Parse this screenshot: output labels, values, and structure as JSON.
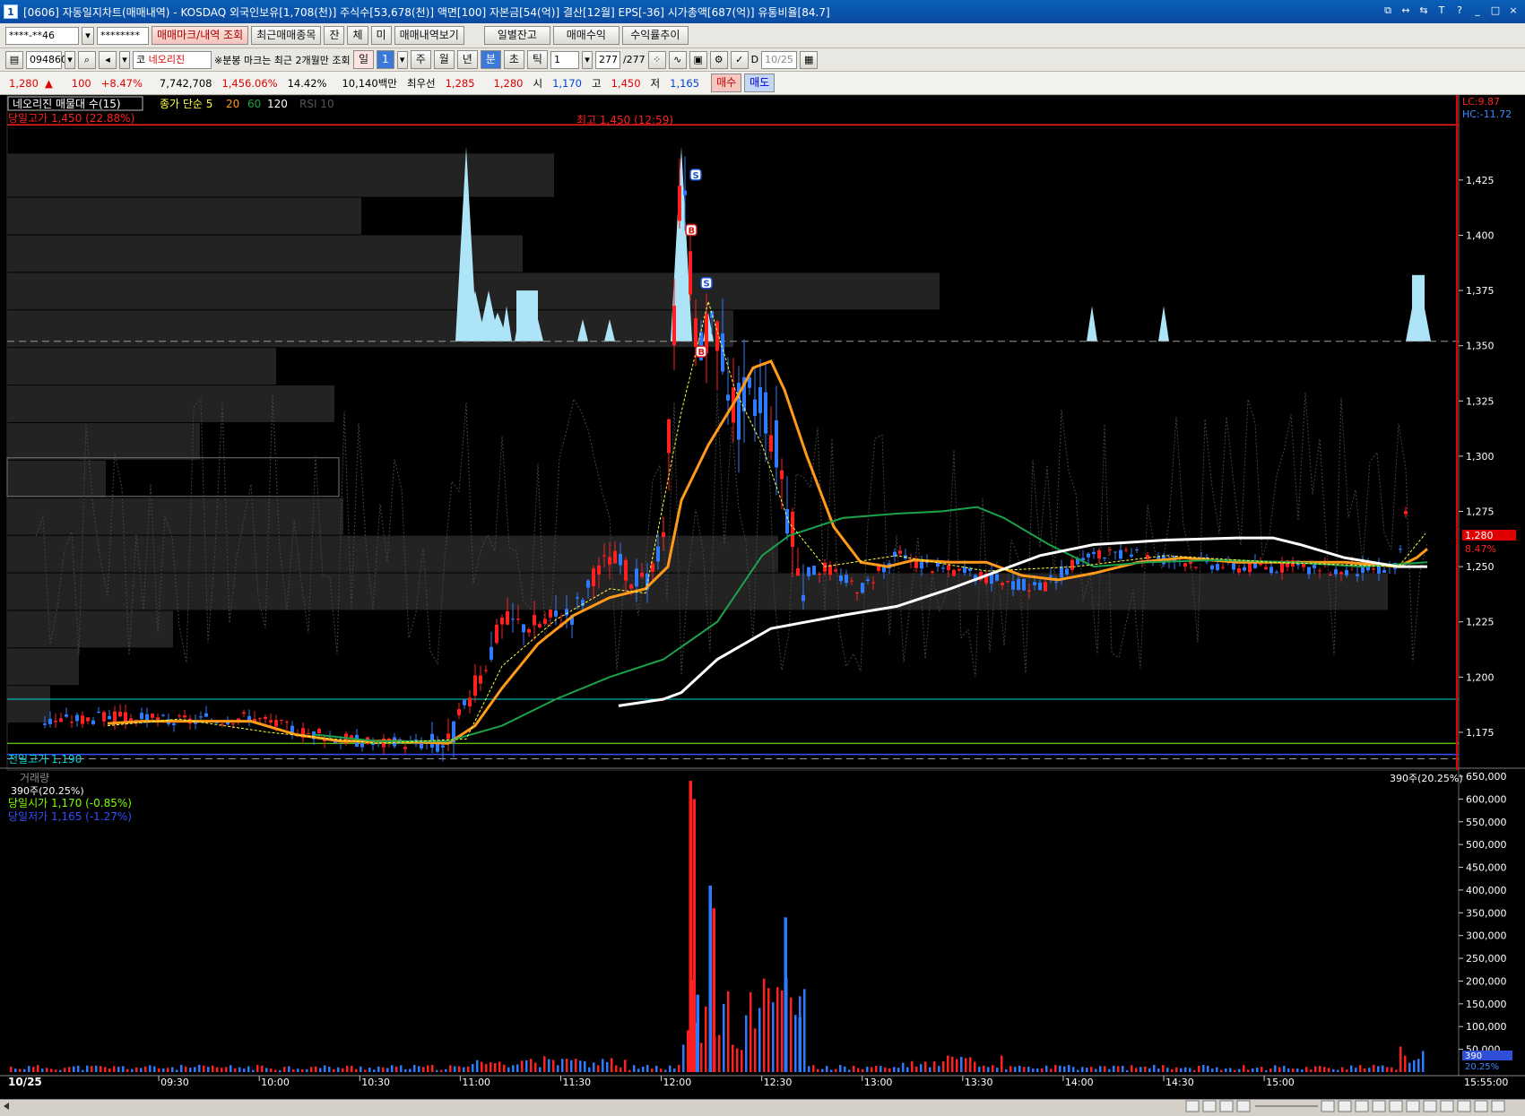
{
  "window": {
    "icon": "1",
    "title": "[0606] 자동일지차트(매매내역) - KOSDAQ 외국인보유[1,708(천)] 주식수[53,678(천)] 액면[100] 자본금[54(억)] 결산[12월] EPS[-36] 시가총액[687(억)] 유통비율[84.7]",
    "buttons": [
      "⧉",
      "↔",
      "⇆",
      "T",
      "?",
      "_",
      "□",
      "×"
    ]
  },
  "toolbar1": {
    "account": "****-**46",
    "password": "********",
    "buttons": [
      "매매마크/내역 조회",
      "최근매매종목",
      "잔",
      "체",
      "미",
      "매매내역보기"
    ],
    "tabs": [
      "일별잔고",
      "매매수익",
      "수익률추이"
    ]
  },
  "toolbar2": {
    "code": "094860",
    "market": "코",
    "name": "네오리진",
    "notice": "※분봉 마크는 최근 2개월만 조회",
    "period_label": "일",
    "period_value": "1",
    "periods": [
      "주",
      "월",
      "년",
      "분",
      "초",
      "틱"
    ],
    "interval": "1",
    "count": "277",
    "count_total": "/277",
    "date_checkbox": "D",
    "date": "10/25"
  },
  "quote": {
    "price": "1,280",
    "arrow": "▲",
    "change": "100",
    "change_pct": "+8.47%",
    "volume": "7,742,708",
    "volume_pct": "1,456.06%",
    "turnover": "14.42%",
    "amount": "10,140백만",
    "best_label": "최우선",
    "ask": "1,285",
    "bid": "1,280",
    "open_label": "시",
    "open": "1,170",
    "high_label": "고",
    "high": "1,450",
    "low_label": "저",
    "low": "1,165",
    "buy": "매수",
    "sell": "매도"
  },
  "chart_legend": {
    "name": "네오리진 매물대 수(15)",
    "ma": "종가 단순 5",
    "ma20": "20",
    "ma60": "60",
    "ma120": "120",
    "rsi": "RSI 10"
  },
  "annotations": {
    "day_high": "당일고가 1,450 (22.88%)",
    "peak": "최고 1,450 (12:59)",
    "prev_high": "전일고가 1,190",
    "day_open": "당일시가 1,170 (-0.85%)",
    "day_low": "당일저가 1,165 (-1.27%)",
    "lc": "LC:9.87",
    "hc": "HC:-11.72",
    "current_price": "1,280",
    "current_pct": "8.47%",
    "vol_label": "거래량",
    "vol_value": "390주(20.25%)",
    "vol_current": "390",
    "vol_current_pct": "20.25%",
    "date": "10/25",
    "last_time": "15:55:00",
    "trade_marks": [
      "S",
      "B",
      "S",
      "B"
    ]
  },
  "chart_data": {
    "type": "candlestick",
    "price_axis": [
      "1,425",
      "1,400",
      "1,375",
      "1,350",
      "1,325",
      "1,300",
      "1,275",
      "1,250",
      "1,225",
      "1,200",
      "1,175"
    ],
    "price_range": [
      1162,
      1457
    ],
    "volume_axis": [
      "650,000",
      "600,000",
      "550,000",
      "500,000",
      "450,000",
      "400,000",
      "350,000",
      "300,000",
      "250,000",
      "200,000",
      "150,000",
      "100,000",
      "50,000"
    ],
    "volume_range": [
      0,
      650000
    ],
    "time_axis": [
      "09:30",
      "10:00",
      "10:30",
      "11:00",
      "11:30",
      "12:00",
      "12:30",
      "13:00",
      "13:30",
      "14:00",
      "14:30",
      "15:00"
    ],
    "ma_lines": [
      "5",
      "20",
      "60",
      "120"
    ],
    "colors": {
      "up": "#ff2020",
      "down": "#2f7bff",
      "ma5": "#ffff44",
      "ma20": "#ff9a1a",
      "ma60": "#1aa34a",
      "ma120": "#ffffff",
      "volume_profile": "#aee4f7",
      "prev_high": "#00d7d7",
      "day_open": "#7fff00",
      "day_low": "#3050ff",
      "day_high": "#ff2020"
    }
  }
}
